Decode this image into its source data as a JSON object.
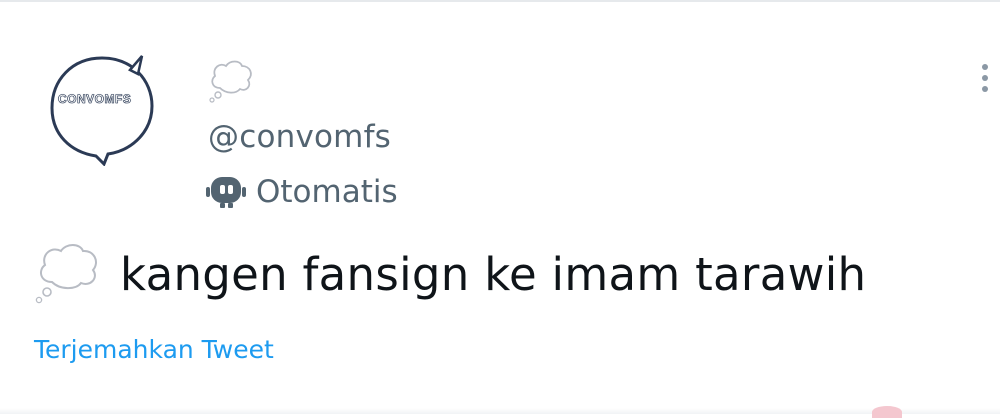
{
  "tweet": {
    "author": {
      "handle": "@convomfs",
      "avatar_text": "CONVOMFS",
      "automated_label": "Otomatis"
    },
    "text": "kangen fansign ke imam tarawih",
    "translate_label": "Terjemahkan Tweet"
  },
  "icons": {
    "avatar": "speech-bubble-logo",
    "name_emoji": "thought-balloon",
    "automated": "robot-icon",
    "more": "more-vertical-icon",
    "text_emoji": "thought-balloon"
  },
  "colors": {
    "link": "#1d9bf0",
    "secondary_text": "#536471",
    "primary_text": "#0f1419",
    "avatar_outline": "#2b3a55"
  }
}
